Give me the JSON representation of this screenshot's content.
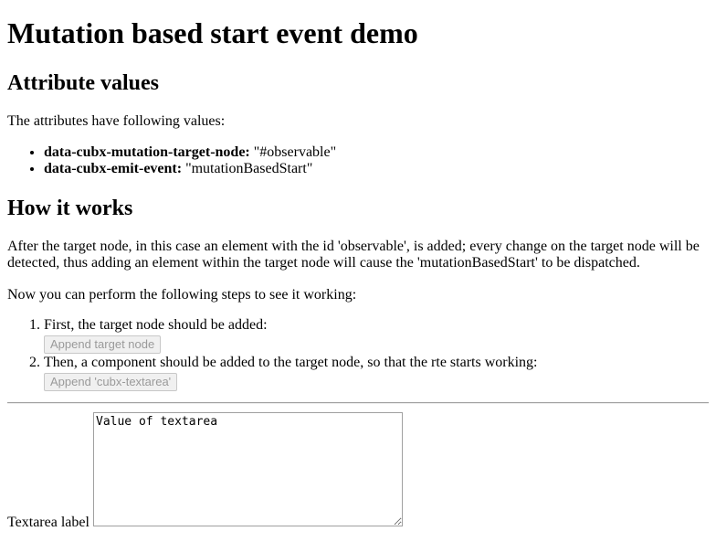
{
  "title": "Mutation based start event demo",
  "attributes_section": {
    "heading": "Attribute values",
    "intro": "The attributes have following values:",
    "items": [
      {
        "name": "data-cubx-mutation-target-node:",
        "value": " \"#observable\""
      },
      {
        "name": "data-cubx-emit-event:",
        "value": " \"mutationBasedStart\""
      }
    ]
  },
  "how_section": {
    "heading": "How it works",
    "description": "After the target node, in this case an element with the id 'observable', is added; every change on the target node will be detected, thus adding an element within the target node will cause the 'mutationBasedStart' to be dispatched.",
    "steps_intro": "Now you can perform the following steps to see it working:",
    "steps": [
      {
        "text": "First, the target node should be added:",
        "button_label": "Append target node"
      },
      {
        "text": "Then, a component should be added to the target node, so that the rte starts working:",
        "button_label": "Append 'cubx-textarea'"
      }
    ]
  },
  "textarea": {
    "label": "Textarea label",
    "value": "Value of textarea"
  }
}
